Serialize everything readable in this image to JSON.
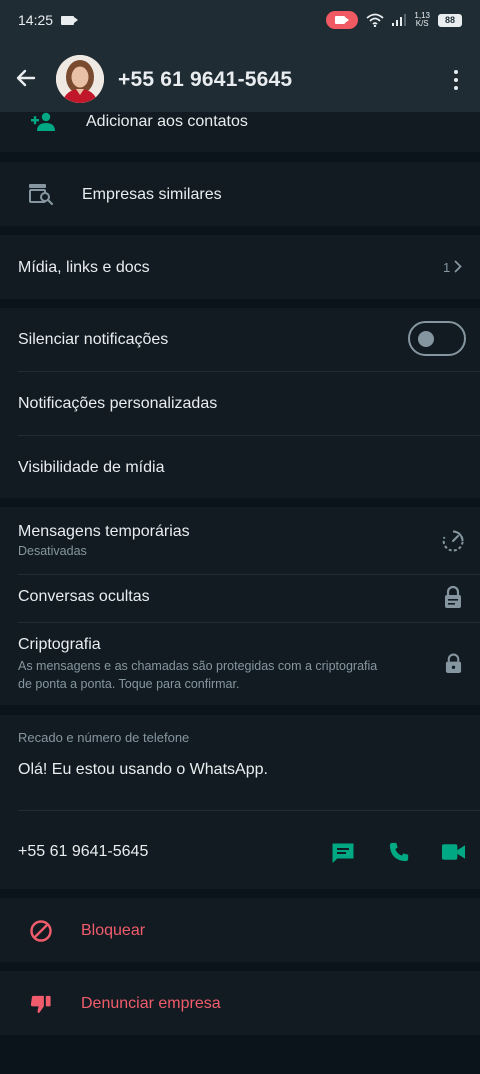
{
  "status": {
    "time": "14:25",
    "net_top": "1,13",
    "net_bottom": "K/S",
    "battery": "88"
  },
  "header": {
    "title": "+55 61 9641-5645"
  },
  "actions": {
    "add_contact": "Adicionar aos contatos",
    "similar_businesses": "Empresas similares"
  },
  "media": {
    "label": "Mídia, links e docs",
    "count": "1"
  },
  "notifications": {
    "mute": "Silenciar notificações",
    "mute_enabled": false,
    "custom": "Notificações personalizadas",
    "media_visibility": "Visibilidade de mídia"
  },
  "privacy": {
    "disappearing": "Mensagens temporárias",
    "disappearing_status": "Desativadas",
    "hidden_chats": "Conversas ocultas",
    "encryption": "Criptografia",
    "encryption_line1": "As mensagens e as chamadas são protegidas com a criptografia",
    "encryption_line2": "de ponta a ponta. Toque para confirmar."
  },
  "about": {
    "header": "Recado e número de telefone",
    "status_text": "Olá! Eu estou usando o WhatsApp.",
    "phone": "+55 61 9641-5645"
  },
  "danger": {
    "block": "Bloquear",
    "report": "Denunciar empresa"
  },
  "colors": {
    "accent": "#00a884",
    "danger": "#f15c6d",
    "background": "#0b141a",
    "surface": "#111b21"
  }
}
